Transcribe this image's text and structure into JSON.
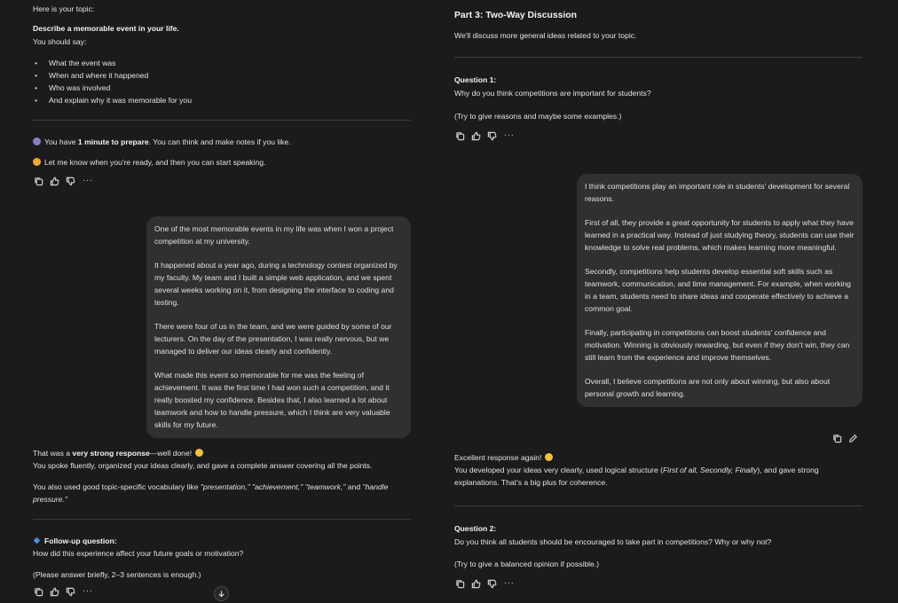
{
  "left": {
    "intro": "Here is your topic:",
    "topic_title": "Describe a memorable event in your life.",
    "should_say": "You should say:",
    "bullets": [
      "What the event was",
      "When and where it happened",
      "Who was involved",
      "And explain why it was memorable for you"
    ],
    "prep_pre": "You have ",
    "prep_bold": "1 minute to prepare",
    "prep_post": ". You can think and make notes if you like.",
    "ready": "Let me know when you're ready, and then you can start speaking.",
    "user_answer": [
      "One of the most memorable events in my life was when I won a project competition at my university.",
      "It happened about a year ago, during a technology contest organized by my faculty. My team and I built a simple web application, and we spent several weeks working on it, from designing the interface to coding and testing.",
      "There were four of us in the team, and we were guided by some of our lecturers. On the day of the presentation, I was really nervous, but we managed to deliver our ideas clearly and confidently.",
      "What made this event so memorable for me was the feeling of achievement. It was the first time I had won such a competition, and it really boosted my confidence. Besides that, I also learned a lot about teamwork and how to handle pressure, which I think are very valuable skills for my future."
    ],
    "fb_pre": "That was a ",
    "fb_bold": "very strong response",
    "fb_post": "—well done!",
    "fb_line2": "You spoke fluently, organized your ideas clearly, and gave a complete answer covering all the points.",
    "vocab_pre": "You also used good topic-specific vocabulary like ",
    "vocab_italic": "\"presentation,\" \"achievement,\" \"teamwork,\"",
    "vocab_and": " and ",
    "vocab_italic2": "\"handle pressure.\"",
    "followup_title": "Follow-up question:",
    "followup_q": "How did this experience affect your future goals or motivation?",
    "followup_note": "(Please answer briefly, 2–3 sentences is enough.)"
  },
  "right": {
    "part_title": "Part 3: Two-Way Discussion",
    "part_sub": "We'll discuss more general ideas related to your topic.",
    "q1_label": "Question 1:",
    "q1_text": "Why do you think competitions are important for students?",
    "q1_note": "(Try to give reasons and maybe some examples.)",
    "user_answer": [
      "I think competitions play an important role in students' development for several reasons.",
      "First of all, they provide a great opportunity for students to apply what they have learned in a practical way. Instead of just studying theory, students can use their knowledge to solve real problems, which makes learning more meaningful.",
      "Secondly, competitions help students develop essential soft skills such as teamwork, communication, and time management. For example, when working in a team, students need to share ideas and cooperate effectively to achieve a common goal.",
      "Finally, participating in competitions can boost students' confidence and motivation. Winning is obviously rewarding, but even if they don't win, they can still learn from the experience and improve themselves.",
      "Overall, I believe competitions are not only about winning, but also about personal growth and learning."
    ],
    "fb_line1": "Excellent response again!",
    "fb2_pre": "You developed your ideas very clearly, used logical structure (",
    "fb2_italic": "First of all, Secondly, Finally",
    "fb2_post": "), and gave strong explanations. That's a big plus for coherence.",
    "q2_label": "Question 2:",
    "q2_text": "Do you think all students should be encouraged to take part in competitions? Why or why not?",
    "q2_note": "(Try to give a balanced opinion if possible.)"
  },
  "icons": {
    "actions": [
      "copy-icon",
      "thumbs-up-icon",
      "thumbs-down-icon",
      "more-icon"
    ],
    "user_actions": [
      "copy-icon",
      "edit-icon"
    ],
    "scroll": "arrow-down-icon"
  },
  "more_glyph": "···",
  "colors": {
    "background": "#1b1b1b",
    "bubble": "#303030",
    "text": "#e3e3e3",
    "divider": "#3c3c3c"
  }
}
